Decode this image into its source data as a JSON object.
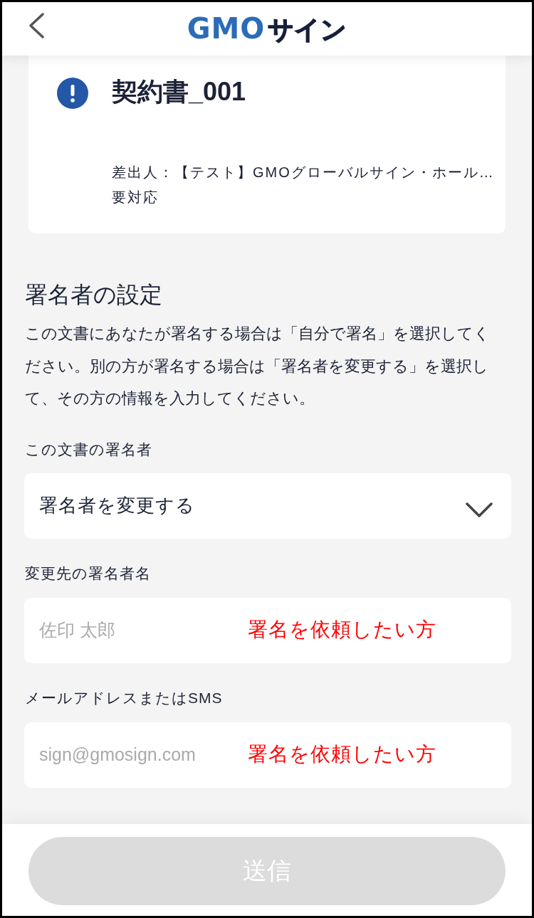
{
  "header": {
    "logo": {
      "brand": "GMO",
      "product": "サイン"
    }
  },
  "document": {
    "alert": true,
    "title": "契約書_001",
    "sender": "差出人：【テスト】GMOグローバルサイン・ホール…",
    "status": "要対応"
  },
  "signer_settings": {
    "heading": "署名者の設定",
    "description": "この文書にあなたが署名する場合は「自分で署名」を選択してください。別の方が署名する場合は「署名者を変更する」を選択して、その方の情報を入力してください。",
    "signer_select": {
      "label": "この文書の署名者",
      "value": "署名者を変更する"
    },
    "fields": [
      {
        "label": "変更先の署名者名",
        "placeholder": "佐印 太郎",
        "annotation": "署名を依頼したい方"
      },
      {
        "label": "メールアドレスまたはSMS",
        "placeholder": "sign@gmosign.com",
        "annotation": "署名を依頼したい方"
      }
    ]
  },
  "footer": {
    "submit": {
      "label": "送信",
      "disabled": true
    }
  }
}
